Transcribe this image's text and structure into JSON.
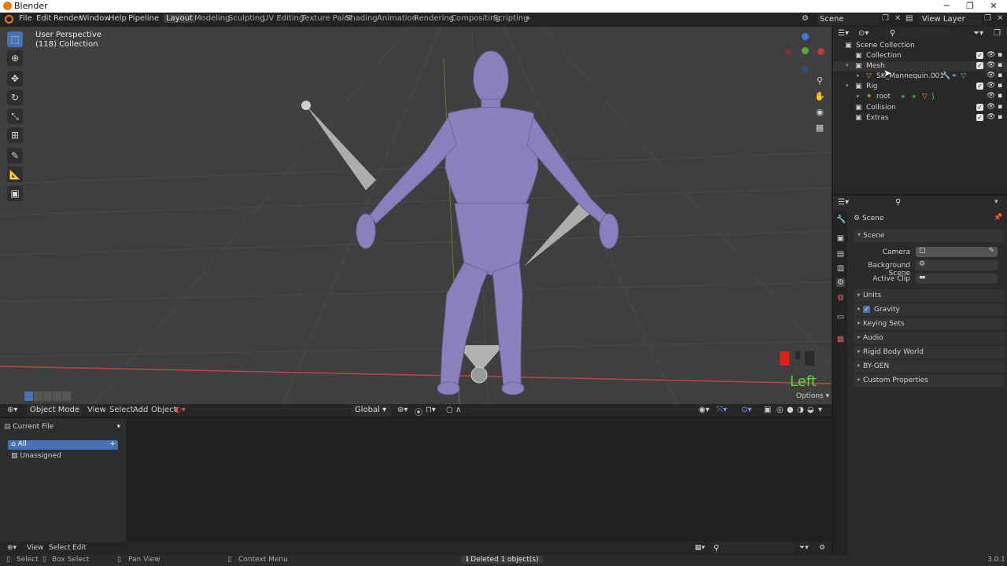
{
  "window": {
    "title": "Blender",
    "controls": [
      "─",
      "❐",
      "✕"
    ]
  },
  "menu": {
    "items": [
      "File",
      "Edit",
      "Render",
      "Window",
      "Help",
      "Pipeline"
    ]
  },
  "workspaces": {
    "tabs": [
      "Layout",
      "Modeling",
      "Sculpting",
      "UV Editing",
      "Texture Paint",
      "Shading",
      "Animation",
      "Rendering",
      "Compositing",
      "Scripting"
    ],
    "add": "+"
  },
  "scene_selector": {
    "value": "Scene"
  },
  "view_layer_selector": {
    "value": "View Layer"
  },
  "viewport": {
    "perspective": "User Perspective",
    "collection": "(118) Collection",
    "view_label": "Left",
    "options_label": "Options",
    "label_color": "#5cdb3a"
  },
  "viewport_header": {
    "mode": "Object Mode",
    "menus": [
      "View",
      "Select",
      "Add",
      "Object"
    ],
    "transform_orientation": "Global"
  },
  "asset_panel": {
    "library": "Current File",
    "items": [
      "All",
      "Unassigned"
    ]
  },
  "bottom_header": {
    "menus": [
      "View",
      "Select",
      "Edit"
    ]
  },
  "status_bar": {
    "items": [
      "Select",
      "Box Select",
      "Pan View",
      "Context Menu"
    ],
    "message": "Deleted 1 object(s)",
    "version": "3.0.1"
  },
  "outliner": {
    "rows": [
      {
        "label": "Scene Collection"
      },
      {
        "label": "Collection"
      },
      {
        "label": "Mesh"
      },
      {
        "label": "SK_Mannequin.001"
      },
      {
        "label": "Rig"
      },
      {
        "label": "root"
      },
      {
        "label": "Collision"
      },
      {
        "label": "Extras"
      }
    ]
  },
  "properties": {
    "context": "Scene",
    "section": "Scene",
    "camera_label": "Camera",
    "background_label": "Background Scene",
    "active_clip_label": "Active Clip",
    "panels": [
      "Units",
      "Gravity",
      "Keying Sets",
      "Audio",
      "Rigid Body World",
      "BY-GEN",
      "Custom Properties"
    ],
    "gravity_checked": true
  },
  "colors": {
    "accent": "#4772b3",
    "mannequin": "#8b80bd",
    "x_axis": "#c23b3b"
  }
}
